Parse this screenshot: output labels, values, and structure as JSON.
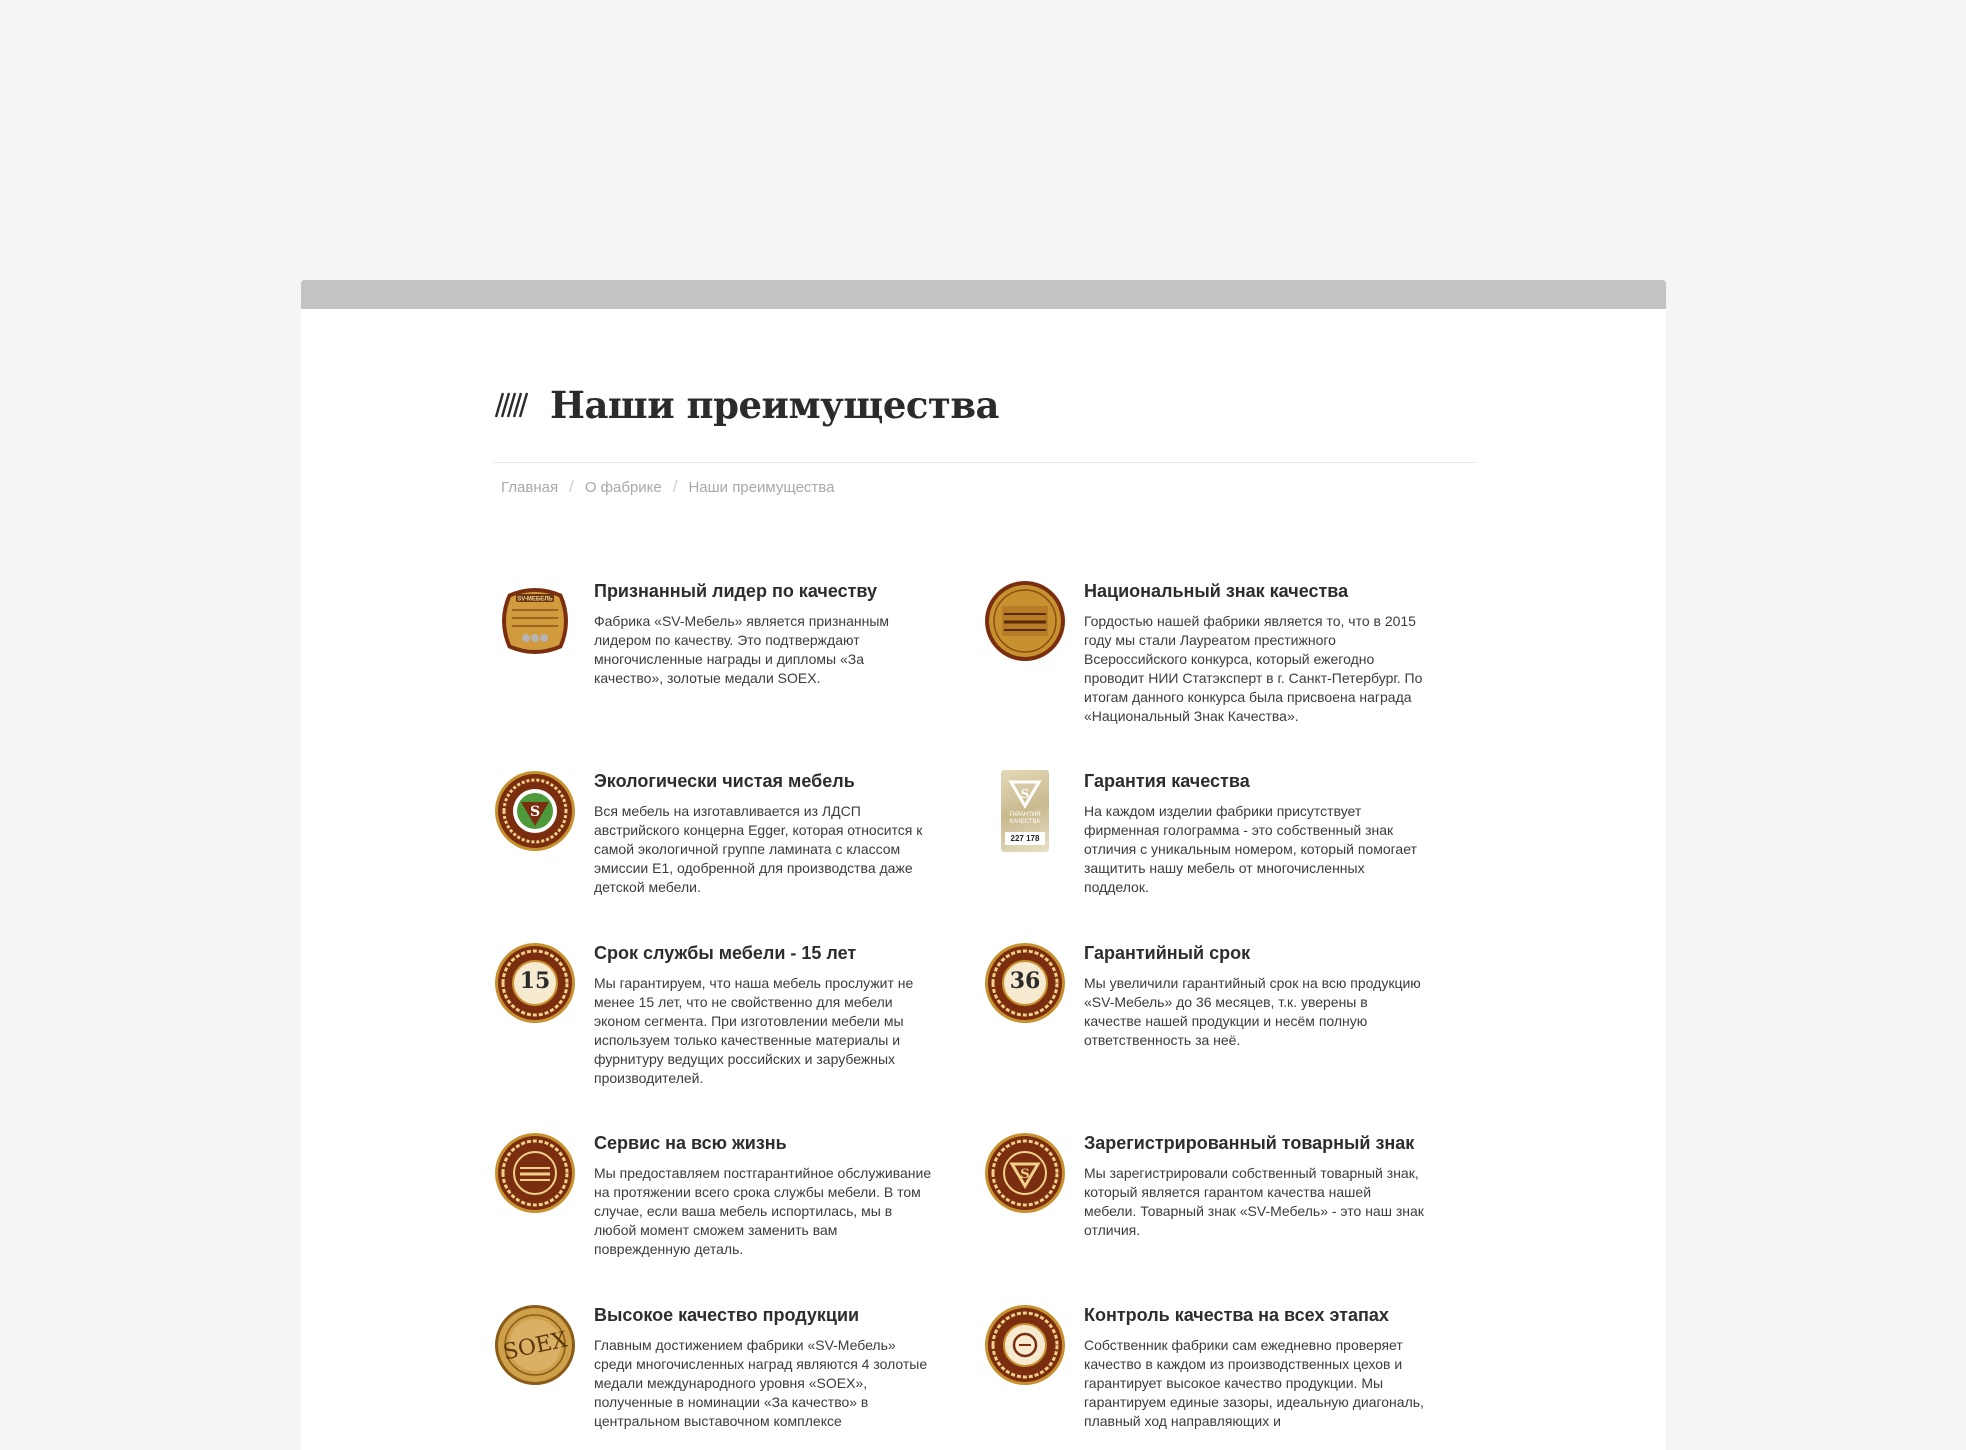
{
  "page": {
    "title": "Наши преимущества"
  },
  "breadcrumb": [
    {
      "label": "Главная"
    },
    {
      "label": "О фабрике"
    },
    {
      "label": "Наши преимущества"
    }
  ],
  "features": [
    {
      "title": "Признанный лидер по качеству",
      "text": "Фабрика «SV-Мебель» является признанным лидером по качеству. Это подтверждают многочисленные награды и дипломы «За качество», золотые медали SOEX.",
      "icon": "sv-mebel-gold-plaque-icon"
    },
    {
      "title": "Национальный знак качества",
      "text": "Гордостью нашей фабрики является то, что в 2015 году мы стали Лауреатом престижного Всероссийского конкурса, который ежегодно проводит НИИ Статэксперт в г. Санкт-Петербург. По итогам данного конкурса была присвоена награда «Национальный Знак Качества».",
      "icon": "national-quality-mark-medal-icon"
    },
    {
      "title": "Экологически чистая мебель",
      "text": "Вся мебель на изготавливается из ЛДСП австрийского концерна Egger, которая относится к самой экологичной группе ламината с классом эмиссии Е1, одобренной для производства даже детской мебели.",
      "icon": "eco-furniture-badge-icon"
    },
    {
      "title": "Гарантия качества",
      "text": "На каждом изделии фабрики присутствует фирменная голограмма - это собственный знак отличия с уникальным номером, который помогает защитить нашу мебель от многочисленных подделок.",
      "icon": "hologram-sticker-icon",
      "sticker_number": "227 178"
    },
    {
      "title": "Срок службы мебели - 15 лет",
      "text": "Мы гарантируем, что наша мебель прослужит не менее 15 лет, что не свойственно для мебели эконом сегмента. При изготовлении мебели мы используем только качественные материалы и фурнитуру ведущих российских и зарубежных производителей.",
      "icon": "service-life-15-years-badge-icon",
      "badge_number": "15"
    },
    {
      "title": "Гарантийный срок",
      "text": "Мы увеличили гарантийный срок на всю продукцию «SV-Мебель» до 36 месяцев, т.к. уверены в качестве нашей продукции и несём полную ответственность за неё.",
      "icon": "warranty-36-months-badge-icon",
      "badge_number": "36"
    },
    {
      "title": "Сервис на всю жизнь",
      "text": "Мы предоставляем постгарантийное обслуживание на протяжении всего срока службы мебели. В том случае, если ваша мебель испортилась, мы в любой момент сможем заменить вам поврежденную деталь.",
      "icon": "lifetime-service-badge-icon"
    },
    {
      "title": "Зарегистрированный товарный знак",
      "text": "Мы зарегистрировали собственный товарный знак, который является гарантом качества нашей мебели. Товарный знак «SV-Мебель» - это наш знак отличия.",
      "icon": "registered-trademark-badge-icon"
    },
    {
      "title": "Высокое качество продукции",
      "text": "Главным достижением фабрики «SV-Мебель» среди многочисленных наград являются 4 золотые медали международного уровня «SOEX», полученные в номинации «За качество» в центральном выставочном комплексе",
      "icon": "soex-gold-medal-icon"
    },
    {
      "title": "Контроль качества на всех этапах",
      "text": "Собственник фабрики сам ежедневно проверяет качество в каждом из производственных цехов и гарантирует высокое качество продукции. Мы гарантируем единые зазоры, идеальную диагональ, плавный ход направляющих и",
      "icon": "quality-control-badge-icon"
    }
  ],
  "colors": {
    "background": "#f4f4f4",
    "panel": "#ffffff",
    "panel_top_bar": "#c3c3c3",
    "title": "#2b2b2b",
    "badge_brown": "#7a2e0f",
    "badge_gold": "#c8912f"
  }
}
